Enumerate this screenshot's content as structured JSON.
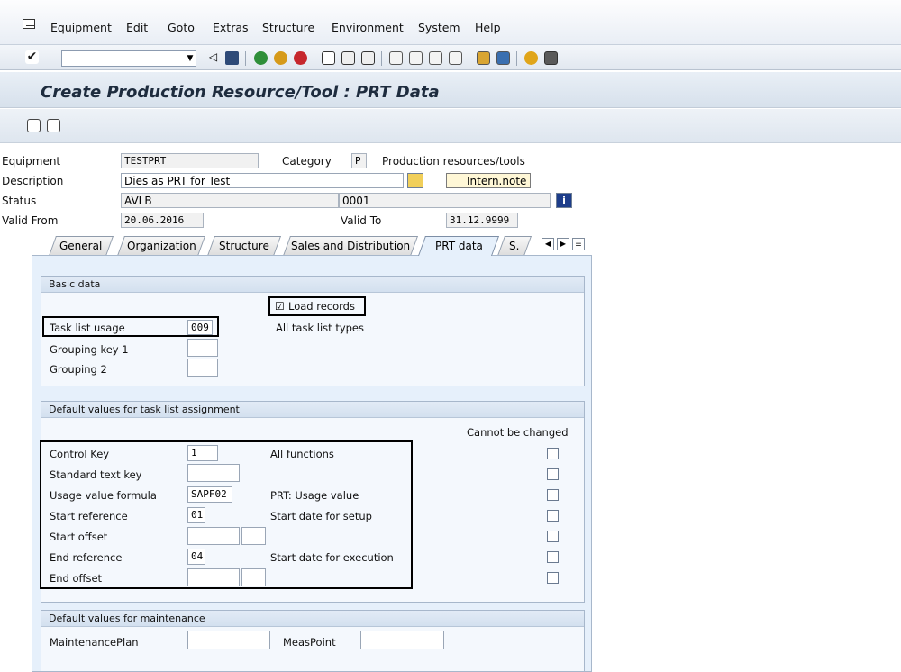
{
  "menu": [
    "Equipment",
    "Edit",
    "Goto",
    "Extras",
    "Structure",
    "Environment",
    "System",
    "Help"
  ],
  "title": "Create Production Resource/Tool : PRT Data",
  "header": {
    "equipment_label": "Equipment",
    "equipment_value": "TESTPRT",
    "category_label": "Category",
    "category_value": "P",
    "category_text": "Production resources/tools",
    "description_label": "Description",
    "description_value": "Dies as PRT for Test",
    "intern_note": "Intern.note",
    "status_label": "Status",
    "status_value": "AVLB",
    "status_code": "0001",
    "valid_from_label": "Valid From",
    "valid_from_value": "20.06.2016",
    "valid_to_label": "Valid To",
    "valid_to_value": "31.12.9999"
  },
  "tabs": [
    "General",
    "Organization",
    "Structure",
    "Sales and Distribution",
    "PRT data",
    "S."
  ],
  "basic": {
    "title": "Basic data",
    "load_records": "Load records",
    "task_list_usage_label": "Task list usage",
    "task_list_usage_value": "009",
    "task_list_usage_text": "All task list types",
    "grouping_key1_label": "Grouping key 1",
    "grouping2_label": "Grouping 2"
  },
  "defaults": {
    "title": "Default values for task list assignment",
    "cannot_change": "Cannot be changed",
    "rows": [
      {
        "label": "Control Key",
        "value": "1",
        "text": "All functions"
      },
      {
        "label": "Standard text key",
        "value": "",
        "text": ""
      },
      {
        "label": "Usage value formula",
        "value": "SAPF02",
        "text": "PRT: Usage value"
      },
      {
        "label": "Start reference",
        "value": "01",
        "text": "Start date for setup"
      },
      {
        "label": "Start offset",
        "value": "",
        "text": ""
      },
      {
        "label": "End reference",
        "value": "04",
        "text": "Start date for execution"
      },
      {
        "label": "End offset",
        "value": "",
        "text": ""
      }
    ]
  },
  "maintenance": {
    "title": "Default values for maintenance",
    "plan_label": "MaintenancePlan",
    "meas_label": "MeasPoint"
  },
  "colors": {
    "accent": "#1e2c3e",
    "panel": "#e6f0fb"
  }
}
